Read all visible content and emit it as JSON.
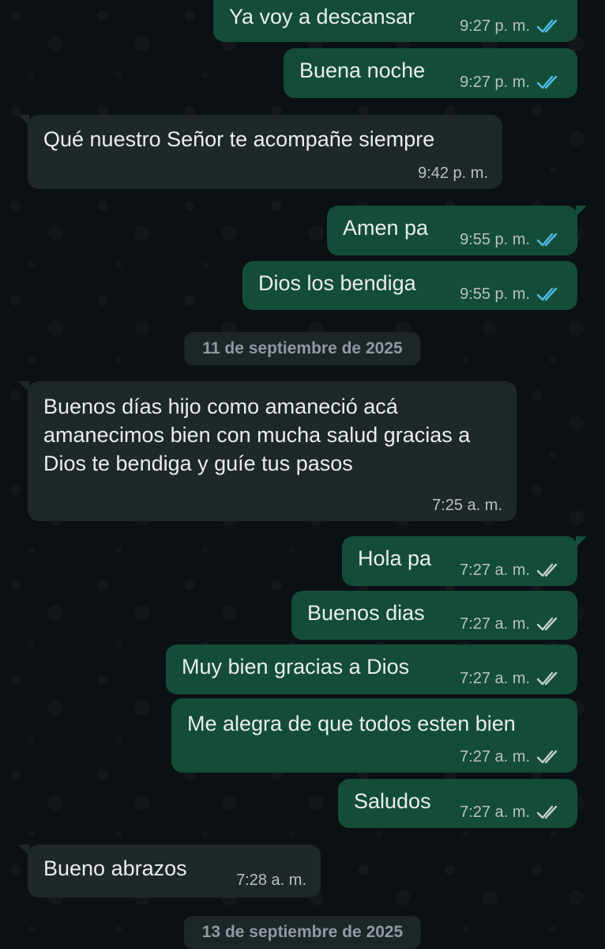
{
  "messages": [
    {
      "text": "Ya voy a descansar",
      "time": "9:27 p. m.",
      "direction": "out",
      "status": "read-check-icon"
    },
    {
      "text": "Buena noche",
      "time": "9:27 p. m.",
      "direction": "out",
      "status": "read-check-icon"
    },
    {
      "text": "Qué nuestro Señor te acompañe siempre",
      "time": "9:42 p. m.",
      "direction": "in"
    },
    {
      "text": "Amen pa",
      "time": "9:55 p. m.",
      "direction": "out",
      "status": "read-check-icon"
    },
    {
      "text": "Dios los bendiga",
      "time": "9:55 p. m.",
      "direction": "out",
      "status": "read-check-icon"
    },
    {
      "text": "Buenos días hijo como amaneció acá amanecimos bien con mucha salud gracias a Dios te bendiga y guíe tus pasos",
      "time": "7:25 a. m.",
      "direction": "in"
    },
    {
      "text": "Hola pa",
      "time": "7:27 a. m.",
      "direction": "out",
      "status": "delivered-check-icon"
    },
    {
      "text": "Buenos dias",
      "time": "7:27 a. m.",
      "direction": "out",
      "status": "delivered-check-icon"
    },
    {
      "text": "Muy bien gracias a Dios",
      "time": "7:27 a. m.",
      "direction": "out",
      "status": "delivered-check-icon"
    },
    {
      "text": "Me alegra de que todos esten bien",
      "time": "7:27 a. m.",
      "direction": "out",
      "status": "delivered-check-icon"
    },
    {
      "text": "Saludos",
      "time": "7:27 a. m.",
      "direction": "out",
      "status": "delivered-check-icon"
    },
    {
      "text": "Bueno abrazos",
      "time": "7:28 a. m.",
      "direction": "in"
    }
  ],
  "date_separators": [
    {
      "label": "11 de septiembre de 2025"
    },
    {
      "label": "13 de septiembre de 2025"
    }
  ],
  "colors": {
    "background": "#0b1014",
    "outgoing_bubble": "#144d37",
    "incoming_bubble": "#1f272a",
    "read_check": "#53bdeb",
    "delivered_check": "#c6cfd3"
  }
}
